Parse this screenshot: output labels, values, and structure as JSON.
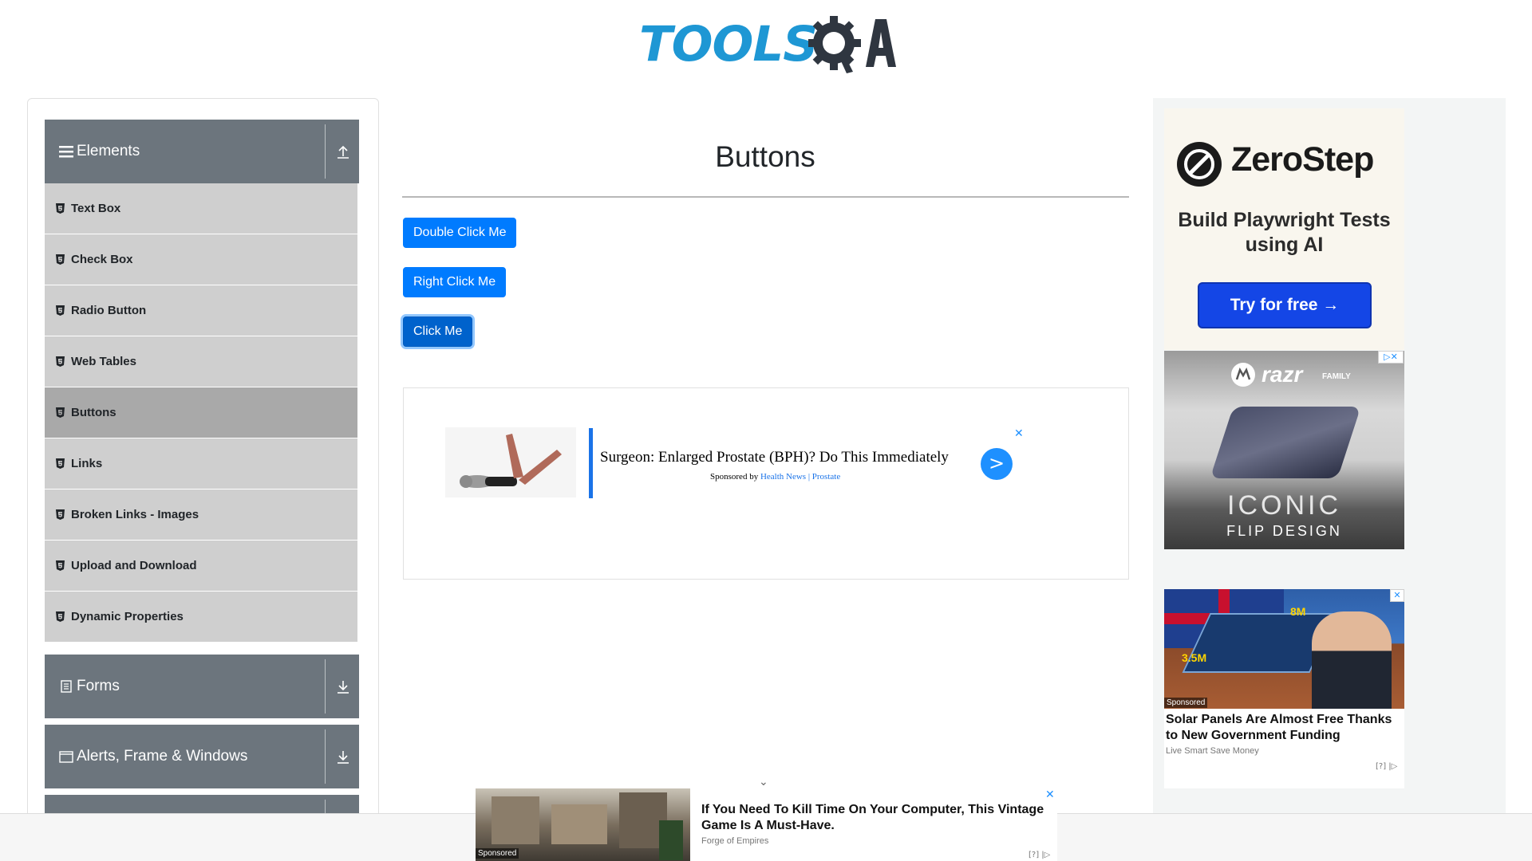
{
  "header": {
    "logo_text": "TOOLSQA"
  },
  "sidebar": {
    "groups": [
      {
        "label": "Elements",
        "arrow": "collapse-up"
      },
      {
        "label": "Forms",
        "arrow": "expand-down"
      },
      {
        "label": "Alerts, Frame & Windows",
        "arrow": "expand-down"
      }
    ],
    "items": [
      {
        "label": "Text Box"
      },
      {
        "label": "Check Box"
      },
      {
        "label": "Radio Button"
      },
      {
        "label": "Web Tables"
      },
      {
        "label": "Buttons",
        "active": true
      },
      {
        "label": "Links"
      },
      {
        "label": "Broken Links - Images"
      },
      {
        "label": "Upload and Download"
      },
      {
        "label": "Dynamic Properties"
      }
    ]
  },
  "main": {
    "title": "Buttons",
    "buttons": {
      "double_click": "Double Click Me",
      "right_click": "Right Click Me",
      "click": "Click Me"
    },
    "ad": {
      "headline": "Surgeon: Enlarged Prostate (BPH)? Do This Immediately",
      "sponsored_prefix": "Sponsored by",
      "sponsor_links": "Health News | Prostate",
      "go_label": ">",
      "close_label": "✕"
    }
  },
  "right_ads": {
    "zerostep": {
      "brand": "ZeroStep",
      "tagline": "Build Playwright Tests using AI",
      "cta": "Try for free →"
    },
    "razr": {
      "brand": "razr",
      "family": "FAMILY",
      "line1": "ICONIC",
      "line2": "FLIP DESIGN",
      "adchoices": "▷✕"
    },
    "solar": {
      "label_8m": "8M",
      "label_35m": "3.5M",
      "sponsored": "Sponsored",
      "headline": "Solar Panels Are Almost Free Thanks to New Government Funding",
      "source": "Live Smart Save Money",
      "adchoices": "[?] |▷"
    }
  },
  "bottom_ad": {
    "chevron": "⌄",
    "sponsored": "Sponsored",
    "headline": "If You Need To Kill Time On Your Computer, This Vintage Game Is A Must-Have.",
    "source": "Forge of Empires",
    "close_label": "✕",
    "adchoices": "[?] |▷"
  },
  "colors": {
    "accent_blue": "#007bff",
    "sidebar_header": "#6c757d",
    "menu_item_bg": "#cfcfcf",
    "menu_item_active": "#a9a9a9",
    "logo_blue": "#1e97d4"
  }
}
